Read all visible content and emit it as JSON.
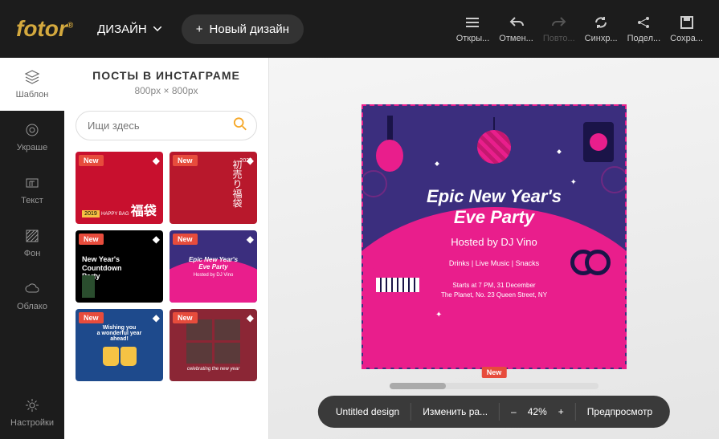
{
  "logo": "fotor",
  "nav": {
    "design": "ДИЗАЙН",
    "new_design": "Новый дизайн"
  },
  "top_actions": {
    "open": "Откры...",
    "undo": "Отмен...",
    "redo": "Повто...",
    "sync": "Синхр...",
    "share": "Подел...",
    "save": "Сохра..."
  },
  "side": {
    "template": "Шаблон",
    "decorate": "Украше",
    "text": "Текст",
    "background": "Фон",
    "cloud": "Облако",
    "settings": "Настройки"
  },
  "panel": {
    "title": "ПОСТЫ В ИНСТАГРАМЕ",
    "dimensions": "800px × 800px",
    "search_placeholder": "Ищи здесь",
    "new_badge": "New"
  },
  "templates": [
    {
      "line1": "HAPPY BAG",
      "line2": "福袋",
      "year": "2019"
    },
    {
      "line1": "初売り",
      "line2": "福袋",
      "year": "2020"
    },
    {
      "line1": "New Year's",
      "line2": "Countdown",
      "line3": "Party"
    },
    {
      "line1": "Epic New Year's",
      "line2": "Eve Party",
      "line3": "Hosted by DJ Vino"
    },
    {
      "line1": "Wishing you",
      "line2": "a wonderful year",
      "line3": "ahead!"
    },
    {
      "line1": "celebrating the new year"
    }
  ],
  "canvas": {
    "title1": "Epic New Year's",
    "title2": "Eve Party",
    "host": "Hosted by DJ Vino",
    "info": "Drinks | Live Music | Snacks",
    "start": "Starts at 7 PM, 31 December",
    "address": "The Planet, No. 23 Queen Street, NY",
    "new_badge": "New"
  },
  "bottombar": {
    "filename": "Untitled design",
    "resize": "Изменить ра...",
    "zoom_out": "–",
    "zoom": "42%",
    "zoom_in": "+",
    "preview": "Предпросмотр"
  }
}
